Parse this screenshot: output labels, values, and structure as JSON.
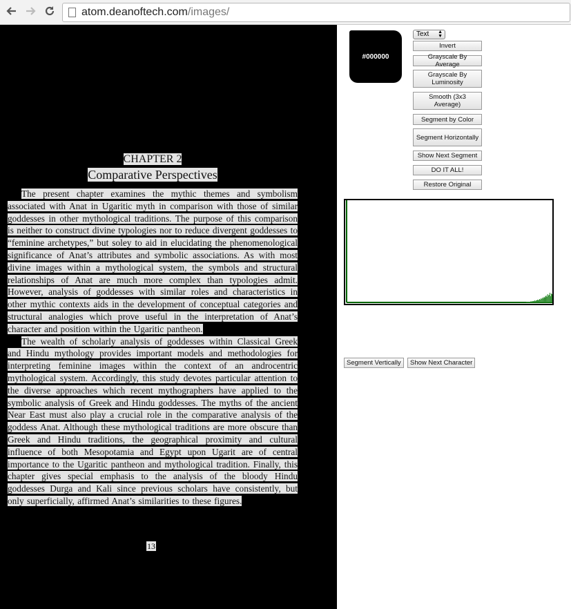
{
  "browser": {
    "back_icon": "arrow-left-icon",
    "forward_icon": "arrow-right-icon",
    "reload_icon": "reload-icon",
    "url_host": "atom.deanoftech.com",
    "url_path": "/images/"
  },
  "document": {
    "chapter": "CHAPTER 2",
    "title": "Comparative Perspectives",
    "paragraphs": [
      "The present chapter examines the mythic themes and symbolism associated with Anat in Ugaritic myth in comparison with those of similar goddesses in other mythological traditions. The purpose of this comparison is neither to construct divine typologies nor to reduce divergent goddesses to “feminine archetypes,” but soley to aid in elucidating the phenomenological significance of Anat’s attributes and symbolic associations. As with most divine images within a mythological system, the symbols and structural relationships of Anat are much more complex than typologies admit. However, analysis of goddesses with similar roles and characteristics in other mythic contexts aids in the development of conceptual categories and structural analogies which prove useful in the interpretation of Anat’s character and position within the Ugaritic pantheon.",
      "The wealth of scholarly analysis of goddesses within Classical Greek and Hindu mythology provides important models and methodologies for interpreting feminine images within the context of an androcentric mythological system. Accordingly, this study devotes particular attention to the diverse approaches which recent mythographers have applied to the symbolic analysis of Greek and Hindu goddesses. The myths of the ancient Near East must also play a crucial role in the comparative analysis of the goddess Anat. Although these mythological traditions are more obscure than Greek and Hindu traditions, the geographical proximity and cultural influence of both Mesopotamia and Egypt upon Ugarit are of central importance to the Ugaritic pantheon and mythological tradition. Finally, this chapter gives special emphasis to the analysis of the bloody Hindu goddesses Durga and Kali since previous scholars have consistently, but only superficially, affirmed Anat’s similarities to these figures."
    ],
    "page_number": "13"
  },
  "controls": {
    "color_swatch": "#000000",
    "mode_select": "Text",
    "buttons": {
      "invert": "Invert",
      "grayscale_avg": "Grayscale By Average",
      "grayscale_lum": "Grayscale By Luminosity",
      "smooth": "Smooth (3x3 Average)",
      "segment_color": "Segment by Color",
      "segment_horiz": "Segment Horizontally",
      "show_next_segment": "Show Next Segment",
      "do_it_all": "DO IT ALL!",
      "restore": "Restore Original"
    },
    "segment_vertically": "Segment Vertically",
    "show_next_character": "Show Next Character"
  },
  "histogram": {
    "axis_color": "#006400",
    "bar_color": "#2e8b2e",
    "bins": [
      0,
      0,
      0,
      0,
      0,
      0,
      0,
      0,
      0,
      0,
      0,
      0,
      0,
      0,
      0,
      0,
      0,
      0,
      0,
      0,
      0,
      0,
      0,
      0,
      0,
      0,
      0,
      0,
      0,
      0,
      0,
      0,
      0,
      0,
      0,
      0,
      0,
      0,
      0,
      0,
      0,
      0,
      0,
      0,
      0,
      0,
      0,
      0,
      0,
      0,
      0,
      0,
      0,
      0,
      0,
      0,
      0,
      0,
      0,
      0,
      0,
      0,
      0,
      0,
      0,
      0,
      0,
      0,
      0,
      0,
      0,
      0,
      0,
      0,
      0,
      0,
      0,
      0,
      0,
      0,
      0,
      0,
      0,
      0,
      0,
      0,
      0,
      0,
      0,
      0,
      0,
      0,
      0,
      0,
      0,
      0,
      0,
      0,
      0,
      0,
      0,
      0,
      0,
      0,
      0,
      0,
      0,
      0,
      0,
      0,
      0,
      0,
      0,
      0,
      0,
      0,
      0,
      0,
      0,
      0,
      0,
      0,
      0,
      0,
      0,
      0,
      0,
      0,
      0,
      0,
      0,
      0,
      0,
      0,
      0,
      0,
      0,
      0,
      0,
      0,
      0,
      0,
      0,
      0,
      0,
      0,
      0,
      0,
      0,
      0,
      0,
      0,
      0,
      0,
      0,
      0,
      0,
      0,
      0,
      0,
      0,
      0,
      0,
      0,
      0,
      0,
      0,
      0,
      0,
      0,
      0,
      0,
      0,
      0,
      0,
      0,
      0,
      0,
      0,
      0,
      0,
      0,
      0,
      0,
      0,
      0,
      0,
      0,
      0,
      0,
      0,
      0,
      0,
      0,
      0,
      0,
      0,
      0,
      0,
      0,
      0,
      0,
      0,
      0,
      0,
      0,
      0,
      0,
      0,
      0,
      0,
      0,
      0,
      0,
      0,
      0,
      0,
      0,
      0,
      0,
      0,
      0,
      0,
      0,
      0,
      0,
      0,
      0,
      0,
      0,
      0,
      0,
      0,
      0,
      0,
      0,
      0,
      0,
      0,
      0,
      0,
      0,
      0,
      0,
      0,
      0,
      0,
      0,
      1,
      1,
      1,
      1,
      1,
      1,
      2,
      1,
      2,
      2,
      2,
      3,
      2,
      3,
      3,
      4,
      3,
      4,
      5,
      4,
      6,
      5,
      7,
      6,
      8,
      7,
      9,
      10,
      8,
      12,
      10,
      11,
      14,
      9,
      13,
      12
    ]
  }
}
